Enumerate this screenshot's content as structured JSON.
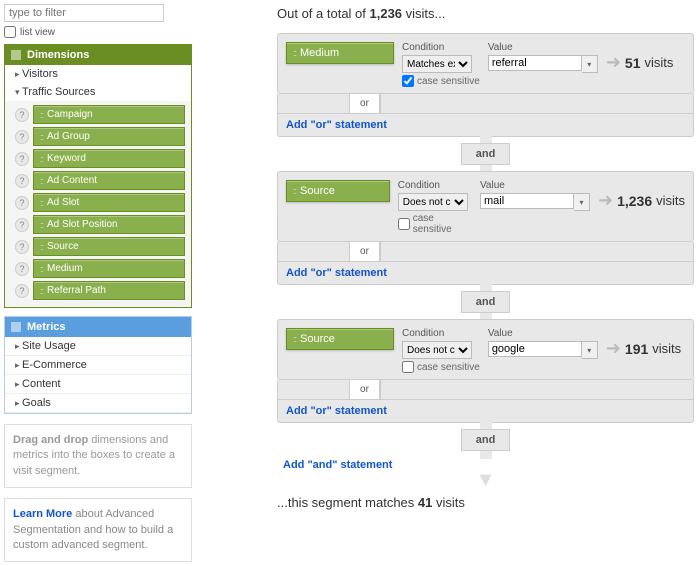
{
  "filter_placeholder": "type to filter",
  "listview_label": "list view",
  "dimensions": {
    "title": "Dimensions",
    "groups": [
      "Visitors",
      "Traffic Sources"
    ],
    "traffic_items": [
      "Campaign",
      "Ad Group",
      "Keyword",
      "Ad Content",
      "Ad Slot",
      "Ad Slot Position",
      "Source",
      "Medium",
      "Referral Path"
    ]
  },
  "metrics": {
    "title": "Metrics",
    "items": [
      "Site Usage",
      "E-Commerce",
      "Content",
      "Goals"
    ]
  },
  "help": {
    "strong": "Drag and drop",
    "rest": " dimensions and metrics into the boxes to create a visit segment."
  },
  "learn": {
    "link": "Learn More",
    "rest": " about Advanced Segmentation and how to build a custom advanced segment."
  },
  "total": {
    "prefix": "Out of a total of ",
    "count": "1,236",
    "suffix": " visits..."
  },
  "labels": {
    "condition": "Condition",
    "value": "Value",
    "case": "case sensitive",
    "or": "or",
    "and": "and",
    "add_or": "Add \"or\" statement",
    "add_and": "Add \"and\" statement",
    "visits": "visits"
  },
  "rules": [
    {
      "dim": "Medium",
      "condition": "Matches exactly",
      "value": "referral",
      "case_checked": true,
      "result": "51"
    },
    {
      "dim": "Source",
      "condition": "Does not contain",
      "value": "mail",
      "case_checked": false,
      "result": "1,236"
    },
    {
      "dim": "Source",
      "condition": "Does not contain",
      "value": "google",
      "case_checked": false,
      "result": "191"
    }
  ],
  "footer": {
    "prefix": "...this segment matches ",
    "count": "41",
    "suffix": " visits"
  }
}
